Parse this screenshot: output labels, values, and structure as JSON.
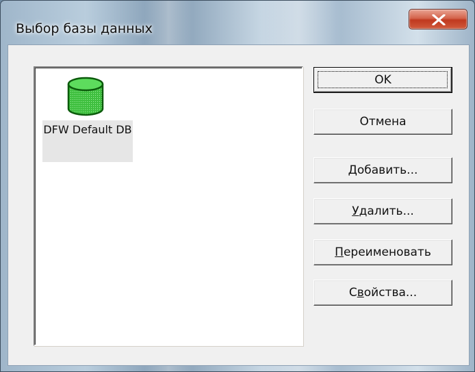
{
  "window": {
    "title": "Выбор базы данных",
    "close_icon": "close-x-icon"
  },
  "databases": [
    {
      "label": "DFW Default DB",
      "icon": "database-cylinder-icon",
      "icon_color": "#3fbf3f"
    }
  ],
  "buttons": {
    "ok": "OK",
    "cancel": "Отмена",
    "add": {
      "mnemonic": "Д",
      "rest": "обавить..."
    },
    "delete": {
      "mnemonic": "У",
      "rest": "далить..."
    },
    "rename": {
      "mnemonic": "П",
      "rest": "ереименовать"
    },
    "properties": {
      "before": "С",
      "mnemonic": "в",
      "rest": "ойства..."
    }
  },
  "colors": {
    "close_button": "#c7422a",
    "dialog_background": "#f0f0f0",
    "list_background": "#ffffff"
  }
}
